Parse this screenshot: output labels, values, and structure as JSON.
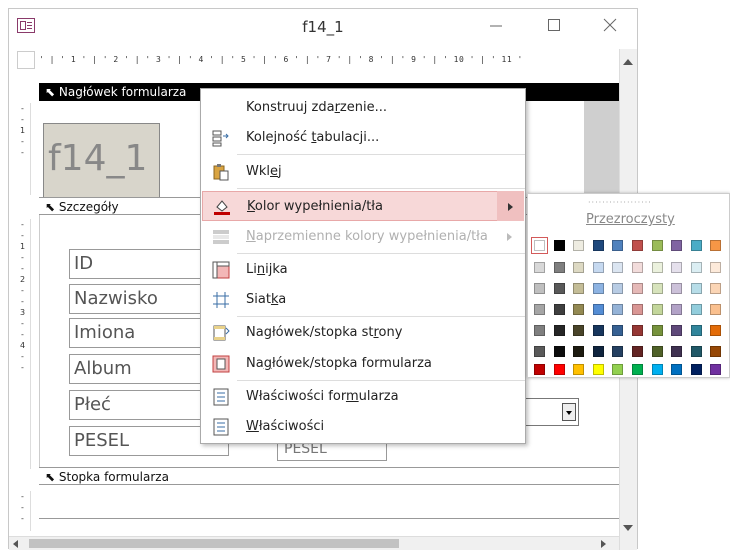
{
  "window": {
    "title": "f14_1"
  },
  "ruler": {
    "marks": "' | ' 1 ' | ' 2 ' | ' 3 ' | ' 4 ' | ' 5 ' | ' 6 ' | ' 7 ' | ' 8 ' | ' 9 ' | ' 10 ' | ' 11 '"
  },
  "vruler": {
    "header": "-\n-\n1\n-\n-",
    "details": "-\n-\n1\n-\n-\n2\n-\n-\n3\n-\n-\n4\n-\n-",
    "footer": "-\n-\n-"
  },
  "sections": {
    "header": "Nagłówek formularza",
    "details": "Szczegóły",
    "footer": "Stopka formularza"
  },
  "form": {
    "logo_text": "f14_1",
    "labels": [
      "ID",
      "Nazwisko",
      "Imiona",
      "Album",
      "Płeć",
      "PESEL"
    ],
    "pesel_control_partial": "PESEL"
  },
  "context_menu": {
    "items": [
      {
        "pre": "Konstruuj zda",
        "u": "r",
        "post": "zenie...",
        "icon": "build-event-icon",
        "disabled": false
      },
      {
        "pre": "Kolejność ",
        "u": "t",
        "post": "abulacji...",
        "icon": "tab-order-icon",
        "disabled": false
      },
      {
        "pre": "Wkl",
        "u": "e",
        "post": "j",
        "icon": "paste-icon",
        "disabled": false
      },
      {
        "pre": "",
        "u": "K",
        "post": "olor wypełnienia/tła",
        "icon": "fill-color-icon",
        "disabled": false,
        "submenu": true
      },
      {
        "pre": "",
        "u": "N",
        "post": "aprzemienne kolory wypełnienia/tła",
        "icon": "alternate-fill-icon",
        "disabled": true,
        "submenu": true
      },
      {
        "pre": "Li",
        "u": "n",
        "post": "ijka",
        "icon": "ruler-icon",
        "disabled": false
      },
      {
        "pre": "Siat",
        "u": "k",
        "post": "a",
        "icon": "grid-icon",
        "disabled": false
      },
      {
        "pre": "Nagłówek/stopka st",
        "u": "r",
        "post": "ony",
        "icon": "page-header-footer-icon",
        "disabled": false
      },
      {
        "pre": "Na",
        "u": "g",
        "post": "łówek/stopka formularza",
        "icon": "form-header-footer-icon",
        "disabled": false
      },
      {
        "pre": "Właściwości for",
        "u": "m",
        "post": "ularza",
        "icon": "form-properties-icon",
        "disabled": false
      },
      {
        "pre": "",
        "u": "W",
        "post": "łaściwości",
        "icon": "properties-icon",
        "disabled": false
      }
    ]
  },
  "palette": {
    "transparent_label": "Przezroczysty",
    "rows": [
      [
        "#ffffff",
        "#000000",
        "#eeece1",
        "#1f497d",
        "#4f81bd",
        "#c0504d",
        "#9bbb59",
        "#8064a2",
        "#4bacc6",
        "#f79646"
      ],
      [
        "#d8d8d8",
        "#7f7f7f",
        "#ddd9c3",
        "#c6d9f0",
        "#dbe5f1",
        "#f2dcdb",
        "#ebf1dd",
        "#e5e0ec",
        "#dbeef3",
        "#fdeada"
      ],
      [
        "#bfbfbf",
        "#595959",
        "#c4bd97",
        "#8db3e2",
        "#b8cce4",
        "#e5b9b7",
        "#d7e3bc",
        "#ccc1d9",
        "#b7dde8",
        "#fbd5b5"
      ],
      [
        "#a5a5a5",
        "#3f3f3f",
        "#938953",
        "#548dd4",
        "#95b3d7",
        "#d99694",
        "#c3d69b",
        "#b2a2c7",
        "#92cddc",
        "#fac08f"
      ],
      [
        "#7f7f7f",
        "#262626",
        "#494429",
        "#17365d",
        "#366092",
        "#953734",
        "#76923c",
        "#5f497a",
        "#31859b",
        "#e36c09"
      ],
      [
        "#595959",
        "#0c0c0c",
        "#1d1b10",
        "#0f243e",
        "#244061",
        "#632423",
        "#4f6128",
        "#3f3151",
        "#205867",
        "#974806"
      ],
      [
        "#c00000",
        "#ff0000",
        "#ffc000",
        "#ffff00",
        "#92d050",
        "#00b050",
        "#00b0f0",
        "#0070c0",
        "#002060",
        "#7030a0"
      ]
    ]
  },
  "colors": {
    "highlight": "#f7d8d8",
    "section_header_bg": "#000000"
  }
}
